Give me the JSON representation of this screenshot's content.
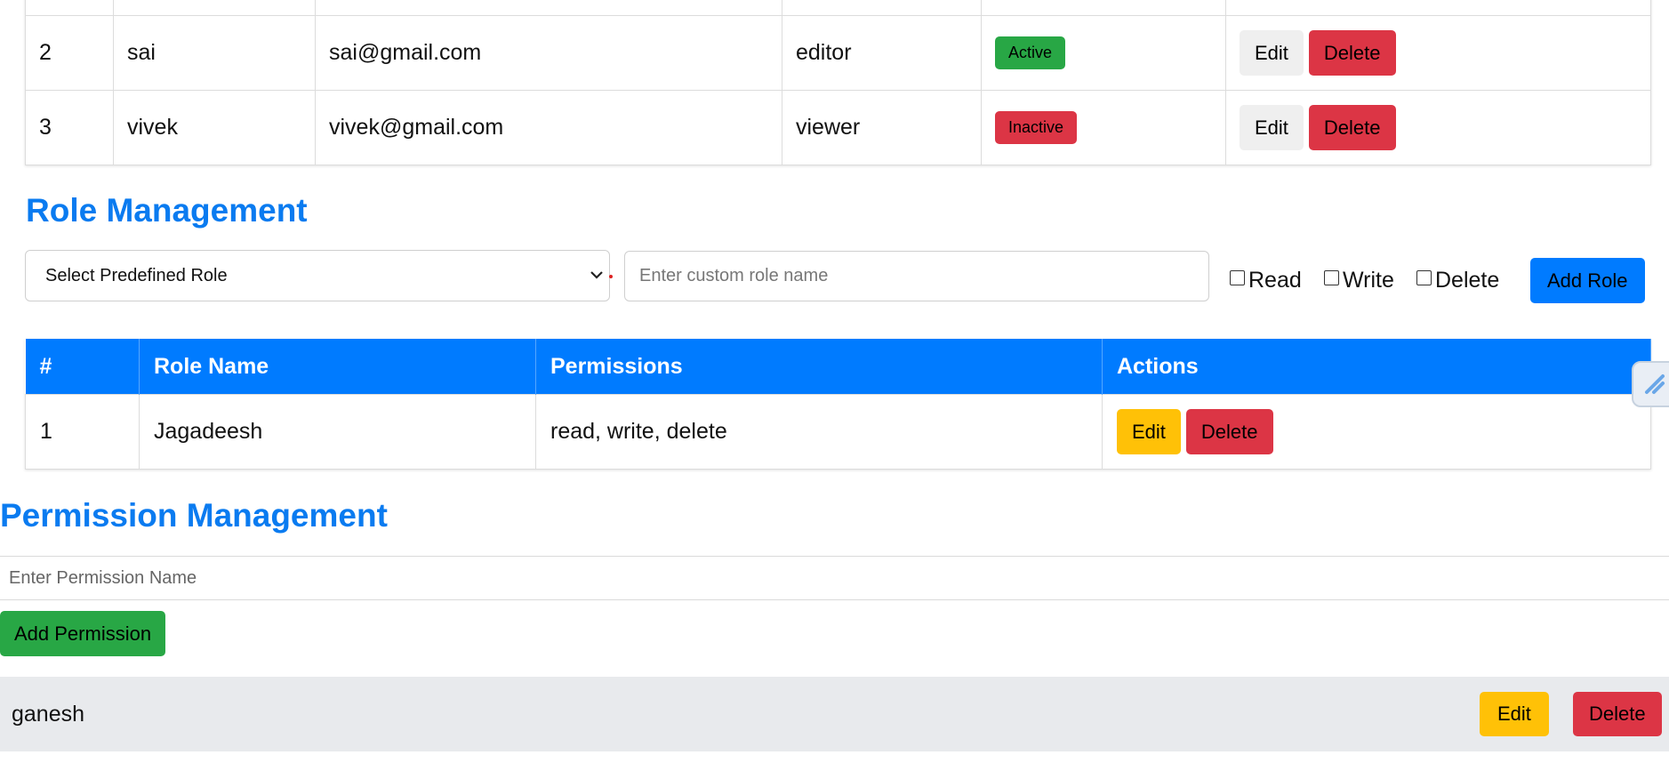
{
  "users": {
    "rows": [
      {
        "id": "2",
        "name": "sai",
        "email": "sai@gmail.com",
        "role": "editor",
        "status": "Active",
        "status_color": "#28a745"
      },
      {
        "id": "3",
        "name": "vivek",
        "email": "vivek@gmail.com",
        "role": "viewer",
        "status": "Inactive",
        "status_color": "#dc3545"
      }
    ],
    "edit_label": "Edit",
    "delete_label": "Delete"
  },
  "role_management": {
    "title": "Role Management",
    "select_value": "Select Predefined Role",
    "custom_placeholder": "Enter custom role name",
    "checkboxes": [
      {
        "label": "Read",
        "checked": false
      },
      {
        "label": "Write",
        "checked": false
      },
      {
        "label": "Delete",
        "checked": false
      }
    ],
    "add_label": "Add Role",
    "table": {
      "headers": [
        "#",
        "Role Name",
        "Permissions",
        "Actions"
      ],
      "rows": [
        {
          "id": "1",
          "name": "Jagadeesh",
          "permissions": "read, write, delete"
        }
      ],
      "edit_label": "Edit",
      "delete_label": "Delete"
    }
  },
  "permission_management": {
    "title": "Permission Management",
    "input_placeholder": "Enter Permission Name",
    "add_label": "Add Permission",
    "items": [
      {
        "name": "ganesh"
      }
    ],
    "edit_label": "Edit",
    "delete_label": "Delete"
  },
  "colors": {
    "primary": "#007bff",
    "heading": "#0a7bf0",
    "success": "#28a745",
    "danger": "#dc3545",
    "warning": "#ffc107"
  }
}
